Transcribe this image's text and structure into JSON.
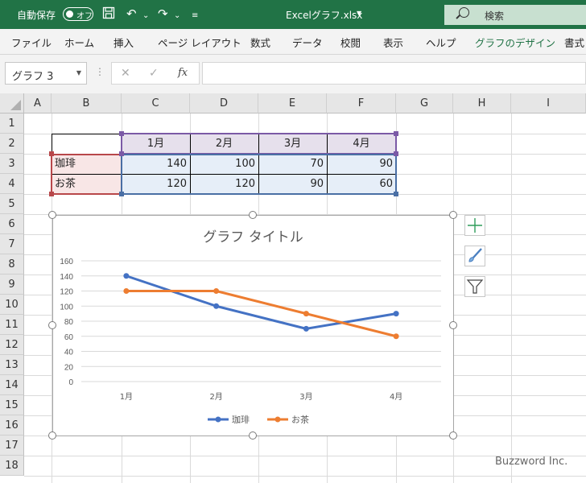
{
  "titlebar": {
    "autosave_label": "自動保存",
    "autosave_state": "オフ",
    "filename": "Excelグラフ.xlsx",
    "search_placeholder": "検索"
  },
  "ribbon_tabs": [
    "ファイル",
    "ホーム",
    "挿入",
    "ページ レイアウト",
    "数式",
    "データ",
    "校閲",
    "表示",
    "ヘルプ",
    "グラフのデザイン",
    "書式"
  ],
  "formula_bar": {
    "name_box": "グラフ 3",
    "formula": ""
  },
  "columns": [
    "A",
    "B",
    "C",
    "D",
    "E",
    "F",
    "G",
    "H",
    "I"
  ],
  "rows": [
    "1",
    "2",
    "3",
    "4",
    "5",
    "6",
    "7",
    "8",
    "9",
    "10",
    "11",
    "12",
    "13",
    "14",
    "15",
    "16",
    "17",
    "18"
  ],
  "table": {
    "headers": [
      "1月",
      "2月",
      "3月",
      "4月"
    ],
    "rows": [
      {
        "label": "珈琲",
        "values": [
          "140",
          "100",
          "70",
          "90"
        ]
      },
      {
        "label": "お茶",
        "values": [
          "120",
          "120",
          "90",
          "60"
        ]
      }
    ]
  },
  "chart_data": {
    "type": "line",
    "title": "グラフ タイトル",
    "categories": [
      "1月",
      "2月",
      "3月",
      "4月"
    ],
    "series": [
      {
        "name": "珈琲",
        "values": [
          140,
          100,
          70,
          90
        ],
        "color": "#4472c4"
      },
      {
        "name": "お茶",
        "values": [
          120,
          120,
          90,
          60
        ],
        "color": "#ed7d31"
      }
    ],
    "yticks": [
      "160",
      "140",
      "120",
      "100",
      "80",
      "60",
      "40",
      "20",
      "0"
    ],
    "ylim": [
      0,
      160
    ],
    "grid": true,
    "legend_position": "bottom"
  },
  "watermark": "Buzzword Inc.",
  "colors": {
    "excel_green": "#217346"
  }
}
